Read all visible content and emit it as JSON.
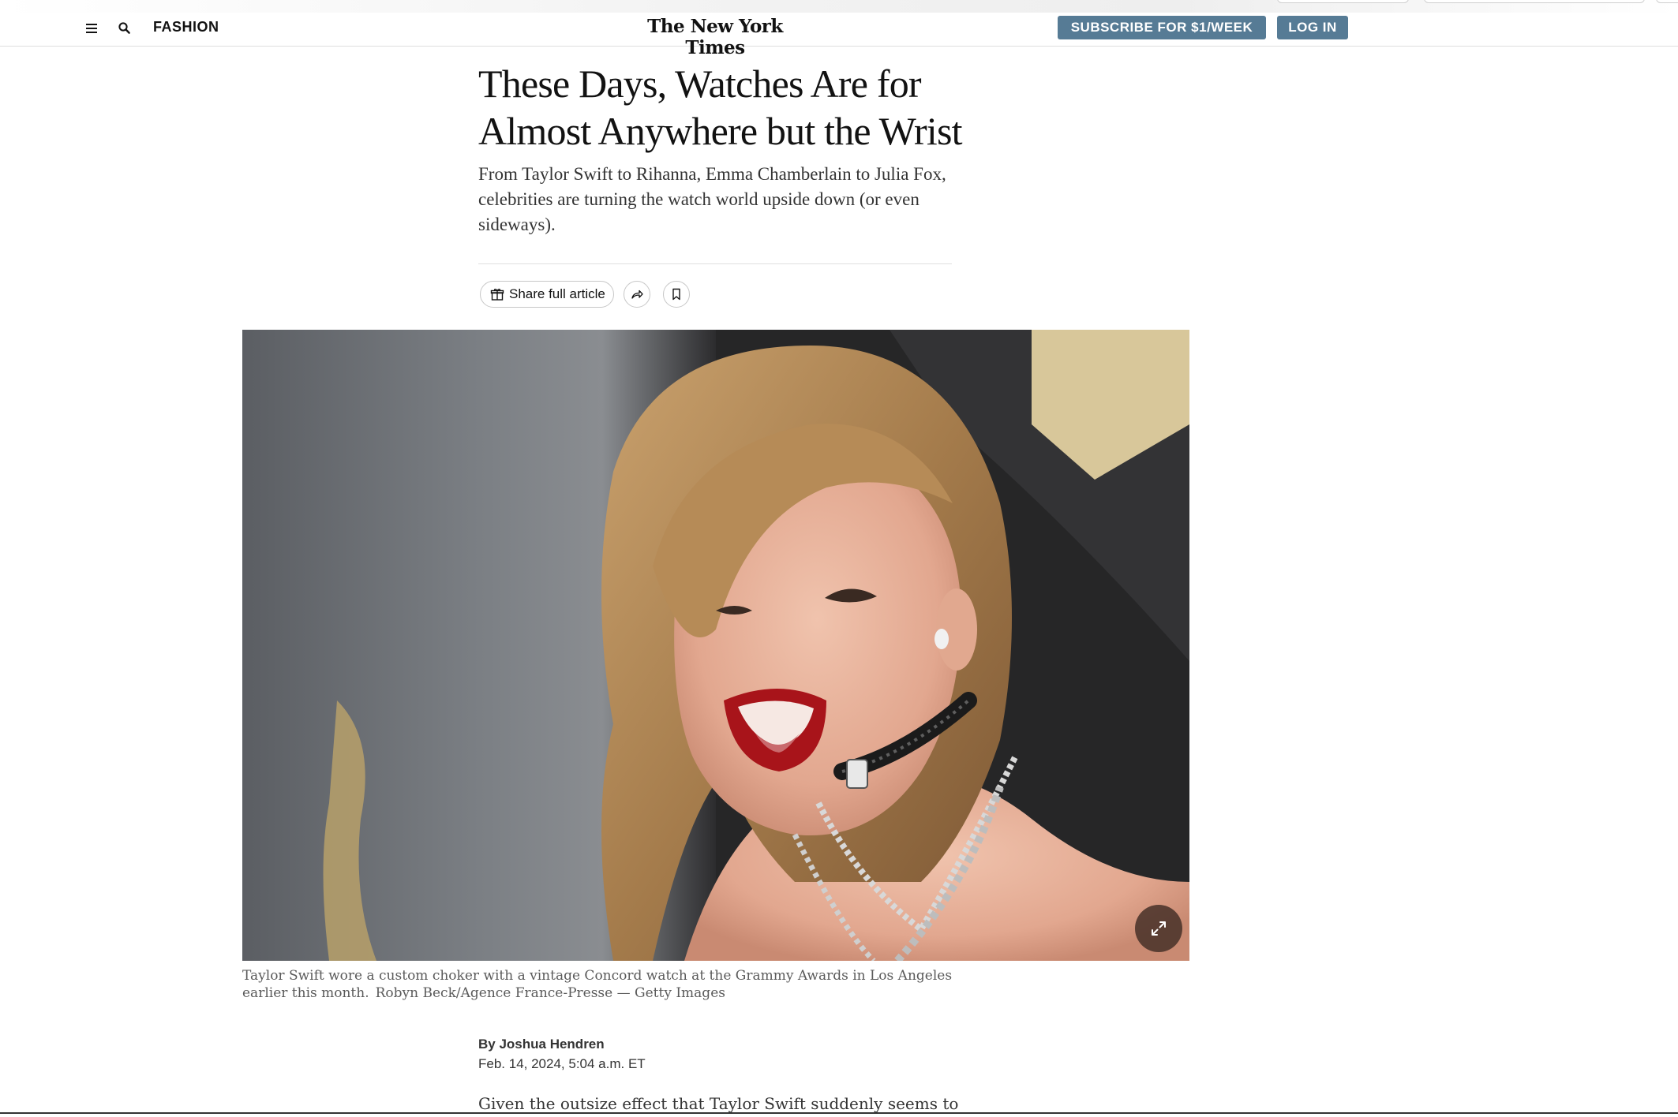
{
  "masthead": {
    "section": "FASHION",
    "logo": "The New York Times",
    "subscribe_label": "SUBSCRIBE FOR $1/WEEK",
    "login_label": "LOG IN"
  },
  "article": {
    "headline": "These Days, Watches Are for Almost Anywhere but the Wrist",
    "summary": "From Taylor Swift to Rihanna, Emma Chamberlain to Julia Fox, celebrities are turning the watch world upside down (or even sideways).",
    "share_full_label": "Share full article",
    "caption": "Taylor Swift wore a custom choker with a vintage Concord watch at the Grammy Awards in Los Angeles earlier this month.",
    "credit": "Robyn Beck/Agence France-Presse — Getty Images",
    "byline": "By Joshua Hendren",
    "date": "Feb. 14, 2024, 5:04 a.m. ET",
    "body_first_line": "Given the outsize effect that Taylor Swift suddenly seems to have"
  },
  "icons": {
    "menu": "hamburger-menu-icon",
    "search": "search-icon",
    "gift": "gift-icon",
    "share": "share-arrow-icon",
    "bookmark": "bookmark-icon",
    "expand": "expand-icon"
  },
  "colors": {
    "button_bg": "#567b95",
    "text": "#121212"
  }
}
